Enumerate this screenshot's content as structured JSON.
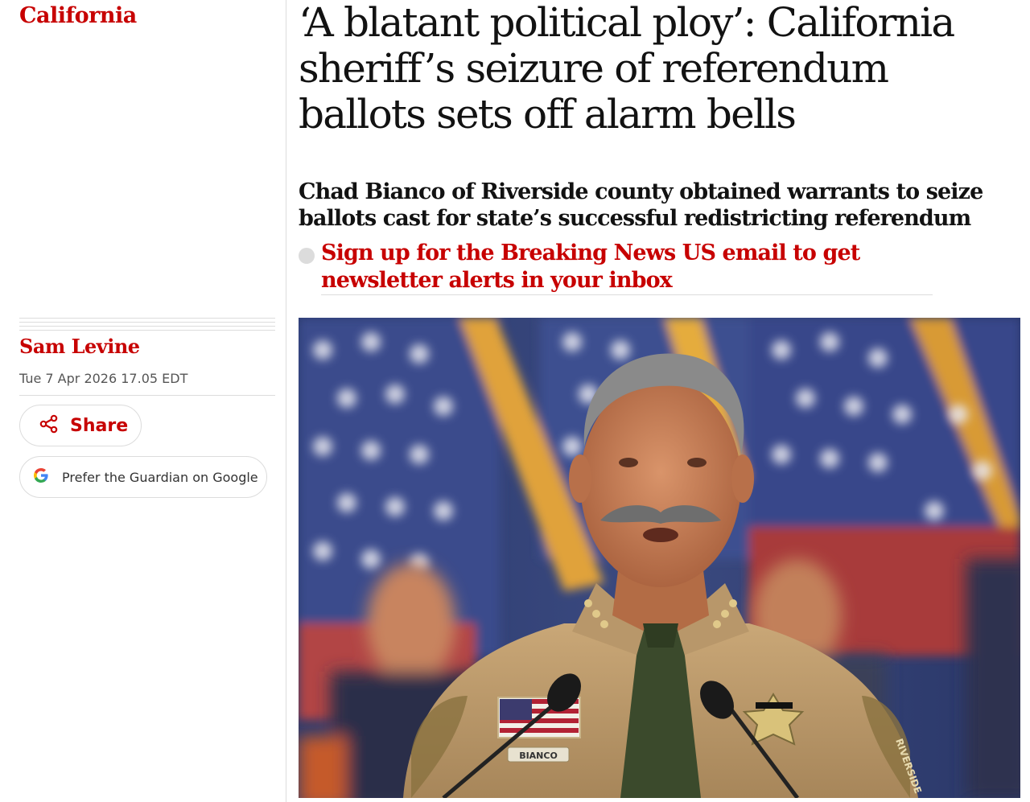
{
  "section": {
    "label": "California"
  },
  "byline": {
    "author": "Sam Levine",
    "date": "Tue 7 Apr 2026 17.05 EDT"
  },
  "actions": {
    "share_label": "Share",
    "google_label": "Prefer the Guardian on Google"
  },
  "article": {
    "headline": "‘A blatant political ploy’: California sheriff’s seizure of referendum ballots sets off alarm bells",
    "standfirst": "Chad Bianco of Riverside county obtained warrants to seize ballots cast for state’s successful redistricting referendum",
    "newsletter_link": "Sign up for the Breaking News US email to get newsletter alerts in your inbox"
  },
  "photo": {
    "name_tag": "BIANCO",
    "patch_text": "RIVERSIDE"
  },
  "icons": {
    "share": "share-icon",
    "google": "google-icon"
  },
  "colors": {
    "accent": "#c70000",
    "rule": "#dcdcdc",
    "text": "#121212"
  }
}
